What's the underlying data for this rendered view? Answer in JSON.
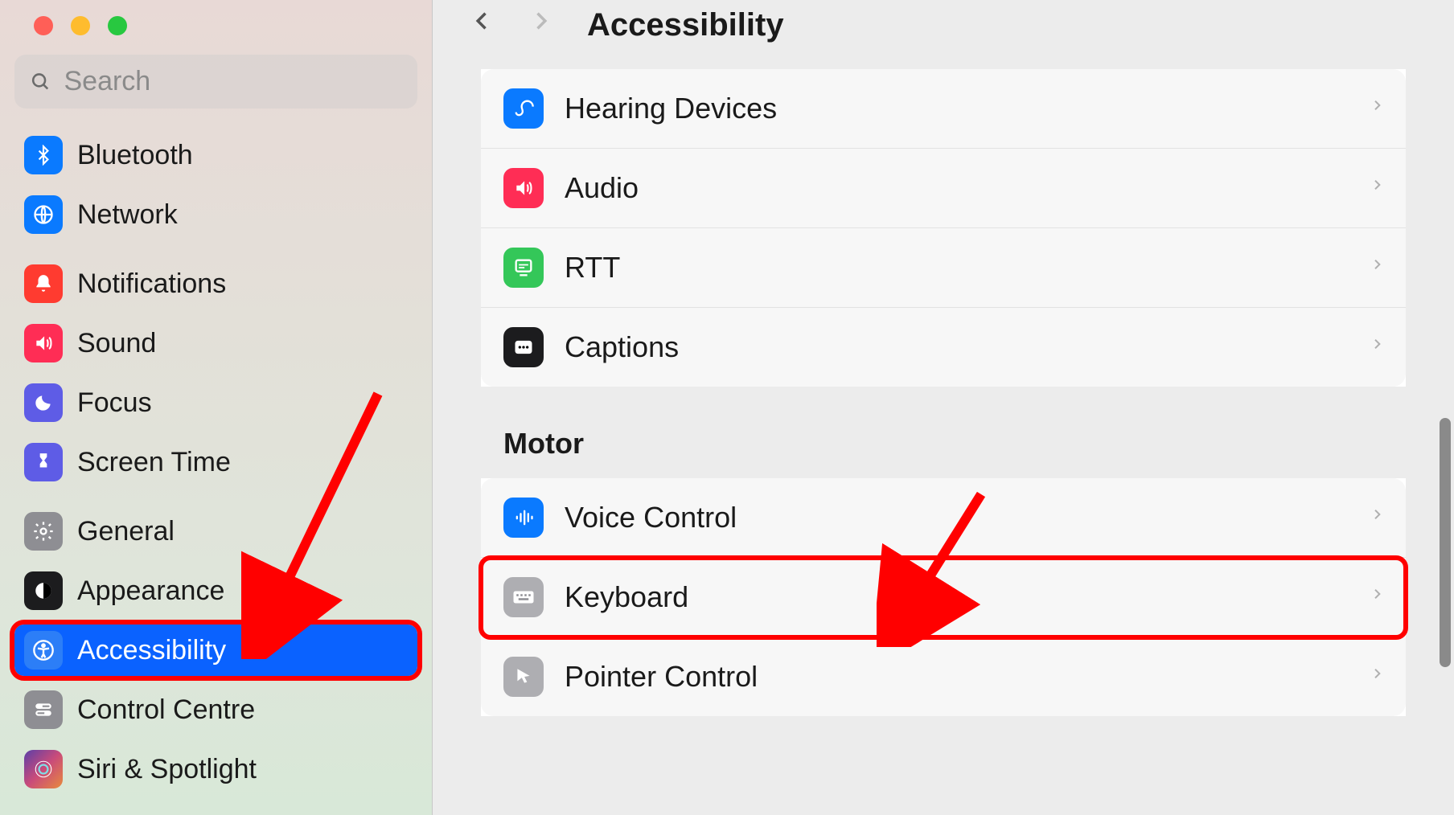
{
  "traffic_lights": [
    "close",
    "minimize",
    "zoom"
  ],
  "search": {
    "placeholder": "Search"
  },
  "sidebar": {
    "groups": [
      {
        "items": [
          {
            "icon": "bluetooth-icon",
            "label": "Bluetooth",
            "bg": "bg-blue"
          },
          {
            "icon": "network-icon",
            "label": "Network",
            "bg": "bg-blue"
          }
        ]
      },
      {
        "items": [
          {
            "icon": "notifications-icon",
            "label": "Notifications",
            "bg": "bg-red"
          },
          {
            "icon": "sound-icon",
            "label": "Sound",
            "bg": "bg-pink"
          },
          {
            "icon": "focus-icon",
            "label": "Focus",
            "bg": "bg-indigo"
          },
          {
            "icon": "screentime-icon",
            "label": "Screen Time",
            "bg": "bg-indigo"
          }
        ]
      },
      {
        "items": [
          {
            "icon": "general-icon",
            "label": "General",
            "bg": "bg-gray"
          },
          {
            "icon": "appearance-icon",
            "label": "Appearance",
            "bg": "bg-black"
          },
          {
            "icon": "accessibility-icon",
            "label": "Accessibility",
            "bg": "bg-blue2",
            "selected": true,
            "highlighted": true
          },
          {
            "icon": "controlcentre-icon",
            "label": "Control Centre",
            "bg": "bg-gray"
          },
          {
            "icon": "siri-icon",
            "label": "Siri & Spotlight",
            "bg": "bg-gradient"
          }
        ]
      }
    ]
  },
  "header": {
    "title": "Accessibility"
  },
  "main": {
    "sections": [
      {
        "header": null,
        "rows": [
          {
            "icon": "hearing-icon",
            "label": "Hearing Devices",
            "bg": "bg-blue"
          },
          {
            "icon": "audio-icon",
            "label": "Audio",
            "bg": "bg-pink"
          },
          {
            "icon": "rtt-icon",
            "label": "RTT",
            "bg": "bg-green"
          },
          {
            "icon": "captions-icon",
            "label": "Captions",
            "bg": "bg-black"
          }
        ]
      },
      {
        "header": "Motor",
        "rows": [
          {
            "icon": "voicecontrol-icon",
            "label": "Voice Control",
            "bg": "bg-blue"
          },
          {
            "icon": "keyboard-icon",
            "label": "Keyboard",
            "bg": "bg-graylight",
            "highlighted": true
          },
          {
            "icon": "pointer-icon",
            "label": "Pointer Control",
            "bg": "bg-graylight"
          }
        ]
      }
    ]
  },
  "annotations": {
    "arrow1": {
      "from": "top-right-of-sidebar",
      "to": "accessibility-item"
    },
    "arrow2": {
      "from": "above-motor-section",
      "to": "keyboard-row"
    }
  }
}
